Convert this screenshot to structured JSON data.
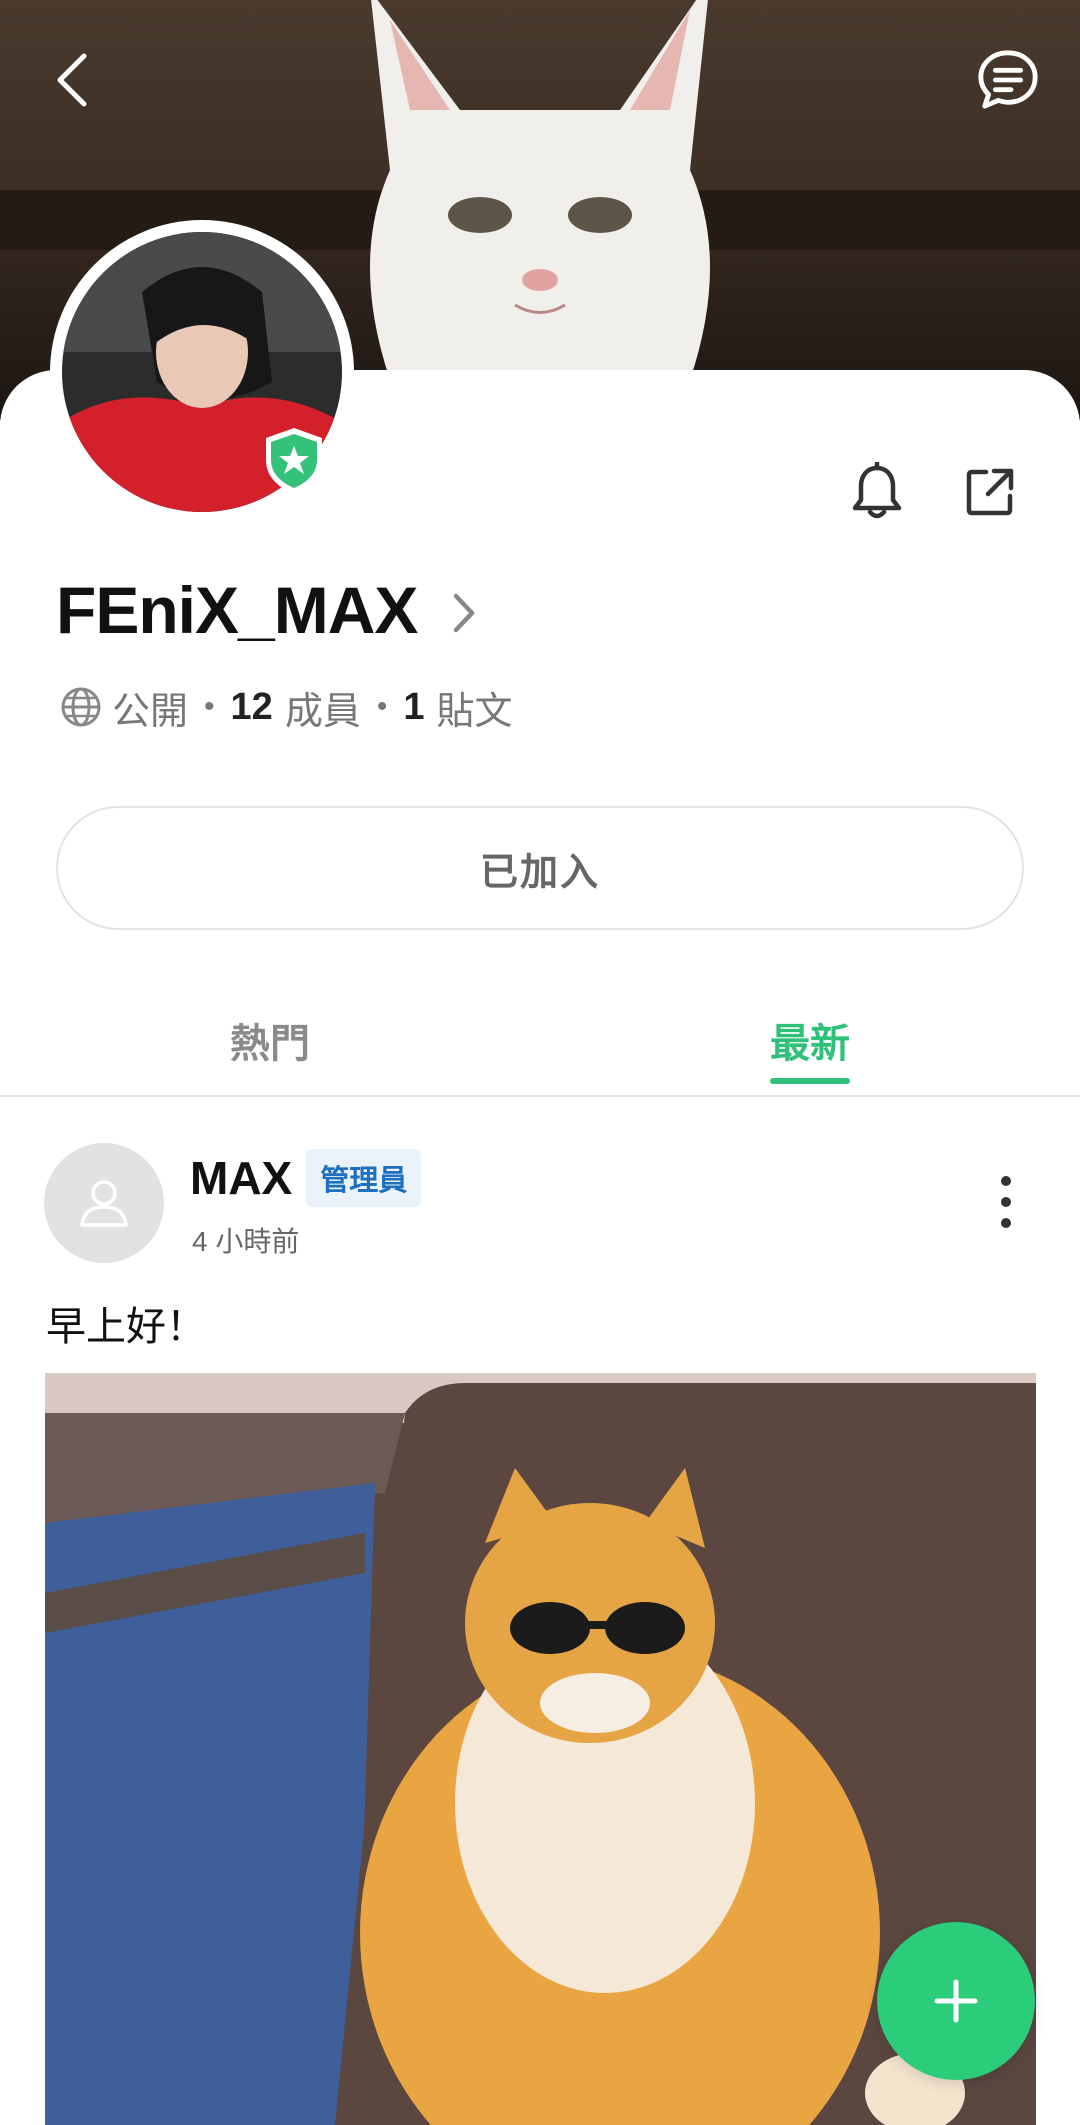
{
  "header": {
    "back_icon": "chevron-left-icon",
    "chat_icon": "chat-bubble-icon"
  },
  "group": {
    "name": "FEniX_MAX",
    "privacy": "公開",
    "member_count": "12",
    "member_label": "成員",
    "post_count": "1",
    "post_label": "貼文",
    "joined_label": "已加入",
    "badge_icon": "star-shield-icon"
  },
  "actions": {
    "bell_icon": "bell-icon",
    "share_icon": "share-icon"
  },
  "tabs": [
    {
      "label": "熱門",
      "active": false
    },
    {
      "label": "最新",
      "active": true
    }
  ],
  "post": {
    "author": "MAX",
    "role_badge": "管理員",
    "time": "4 小時前",
    "text": "早上好！"
  },
  "colors": {
    "accent": "#2fc17a",
    "admin_badge_bg": "#eaf3fb",
    "admin_badge_text": "#1f6fbf",
    "fab": "#2bcc7a"
  },
  "fab": {
    "icon": "plus-icon"
  }
}
